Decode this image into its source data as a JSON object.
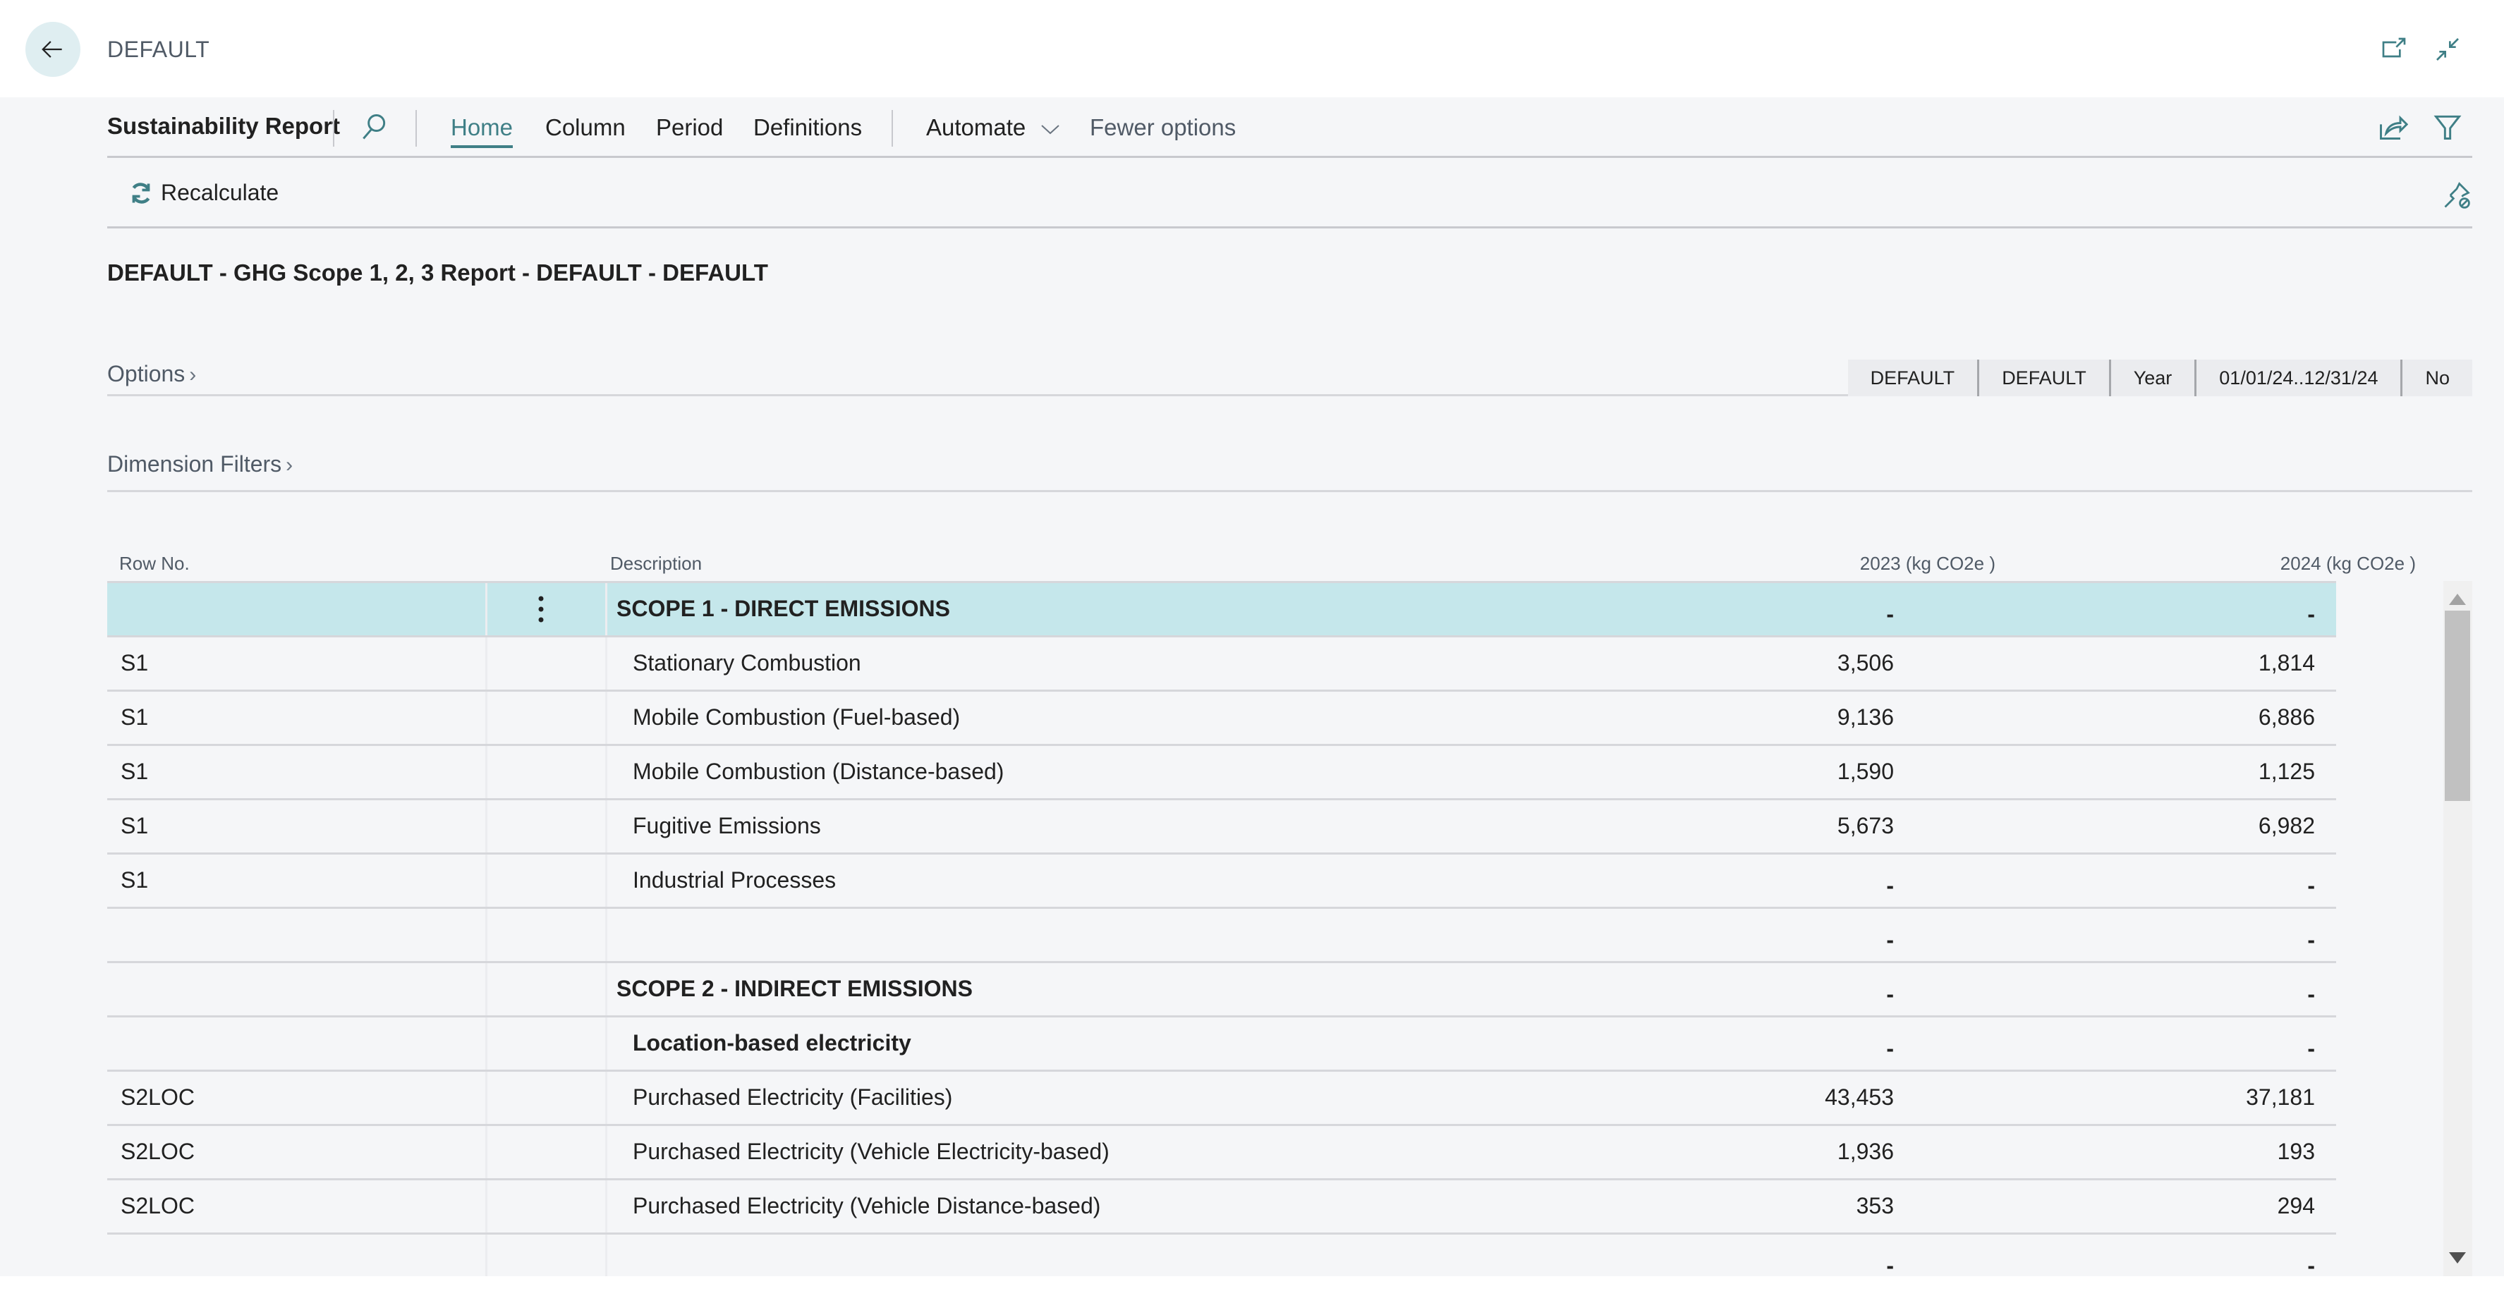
{
  "header": {
    "title": "DEFAULT",
    "icons": [
      "back-arrow-icon",
      "open-new-window-icon",
      "collapse-icon"
    ]
  },
  "navbar": {
    "page_title": "Sustainability Report",
    "tabs": [
      {
        "label": "Home",
        "active": true
      },
      {
        "label": "Column",
        "active": false
      },
      {
        "label": "Period",
        "active": false
      },
      {
        "label": "Definitions",
        "active": false
      }
    ],
    "automate_label": "Automate",
    "fewer_options_label": "Fewer options",
    "right_icons": [
      "share-icon",
      "filter-icon"
    ]
  },
  "actionbar": {
    "recalculate_label": "Recalculate",
    "pin_icon": "unpin-icon"
  },
  "report_title": "DEFAULT - GHG Scope 1, 2, 3 Report - DEFAULT - DEFAULT",
  "options": {
    "label": "Options",
    "chips": [
      "DEFAULT",
      "DEFAULT",
      "Year",
      "01/01/24..12/31/24",
      "No"
    ]
  },
  "dimension_filters": {
    "label": "Dimension Filters"
  },
  "table": {
    "columns": {
      "row_no": "Row No.",
      "description": "Description",
      "col_2023": "2023 (kg CO2e )",
      "col_2024": "2024 (kg CO2e )"
    },
    "rows": [
      {
        "row_no": "",
        "description": "SCOPE 1 - DIRECT EMISSIONS",
        "v2023": "-",
        "v2024": "-",
        "style": "header",
        "selected": true
      },
      {
        "row_no": "S1",
        "description": "Stationary Combustion",
        "v2023": "3,506",
        "v2024": "1,814",
        "style": "normal"
      },
      {
        "row_no": "S1",
        "description": "Mobile Combustion (Fuel-based)",
        "v2023": "9,136",
        "v2024": "6,886",
        "style": "normal"
      },
      {
        "row_no": "S1",
        "description": "Mobile Combustion (Distance-based)",
        "v2023": "1,590",
        "v2024": "1,125",
        "style": "normal"
      },
      {
        "row_no": "S1",
        "description": "Fugitive Emissions",
        "v2023": "5,673",
        "v2024": "6,982",
        "style": "normal"
      },
      {
        "row_no": "S1",
        "description": "Industrial Processes",
        "v2023": "-",
        "v2024": "-",
        "style": "normal"
      },
      {
        "row_no": "",
        "description": "",
        "v2023": "-",
        "v2024": "-",
        "style": "normal"
      },
      {
        "row_no": "",
        "description": "SCOPE 2 - INDIRECT EMISSIONS",
        "v2023": "-",
        "v2024": "-",
        "style": "header"
      },
      {
        "row_no": "",
        "description": "Location-based electricity",
        "v2023": "-",
        "v2024": "-",
        "style": "subheader"
      },
      {
        "row_no": "S2LOC",
        "description": "Purchased Electricity (Facilities)",
        "v2023": "43,453",
        "v2024": "37,181",
        "style": "normal"
      },
      {
        "row_no": "S2LOC",
        "description": "Purchased Electricity (Vehicle Electricity-based)",
        "v2023": "1,936",
        "v2024": "193",
        "style": "normal"
      },
      {
        "row_no": "S2LOC",
        "description": "Purchased Electricity (Vehicle Distance-based)",
        "v2023": "353",
        "v2024": "294",
        "style": "normal"
      },
      {
        "row_no": "",
        "description": "",
        "v2023": "-",
        "v2024": "-",
        "style": "normal"
      }
    ]
  },
  "colors": {
    "accent": "#3f7f86",
    "selected_row": "#c5e7eb",
    "page_background": "#f5f6f8"
  }
}
